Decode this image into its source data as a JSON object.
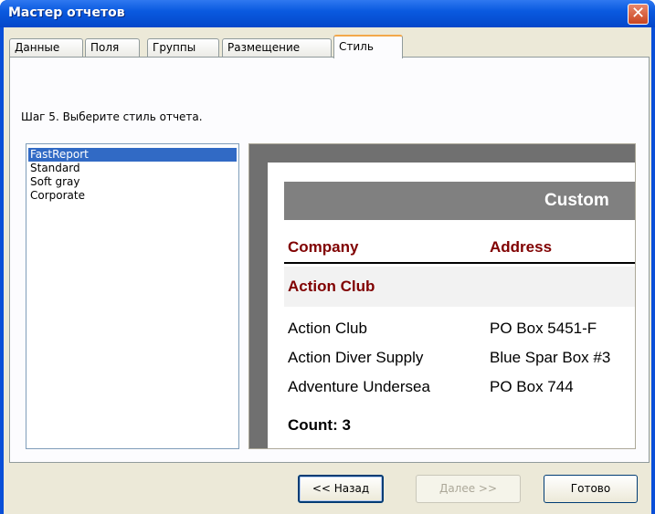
{
  "window": {
    "title": "Мастер отчетов",
    "close_label": "✕"
  },
  "tabs": [
    {
      "label": "Данные"
    },
    {
      "label": "Поля"
    },
    {
      "label": "Группы"
    },
    {
      "label": "Размещение"
    },
    {
      "label": "Стиль",
      "active": true
    }
  ],
  "step_text": "Шаг 5. Выберите стиль отчета.",
  "styles": [
    {
      "label": "FastReport",
      "selected": true
    },
    {
      "label": "Standard"
    },
    {
      "label": "Soft gray"
    },
    {
      "label": "Corporate"
    }
  ],
  "preview": {
    "banner_title": "Custom",
    "columns": [
      "Company",
      "Address"
    ],
    "group_header": "Action Club",
    "rows": [
      {
        "company": "Action Club",
        "address": "PO Box 5451-F"
      },
      {
        "company": "Action Diver Supply",
        "address": "Blue Spar Box #3"
      },
      {
        "company": "Adventure Undersea",
        "address": "PO Box 744"
      }
    ],
    "footer": "Count: 3"
  },
  "buttons": {
    "back": "<< Назад",
    "next": "Далее >>",
    "finish": "Готово"
  },
  "colors": {
    "title_bar": "#0a5ae0",
    "accent_red": "#800000",
    "selection": "#316ac5"
  }
}
